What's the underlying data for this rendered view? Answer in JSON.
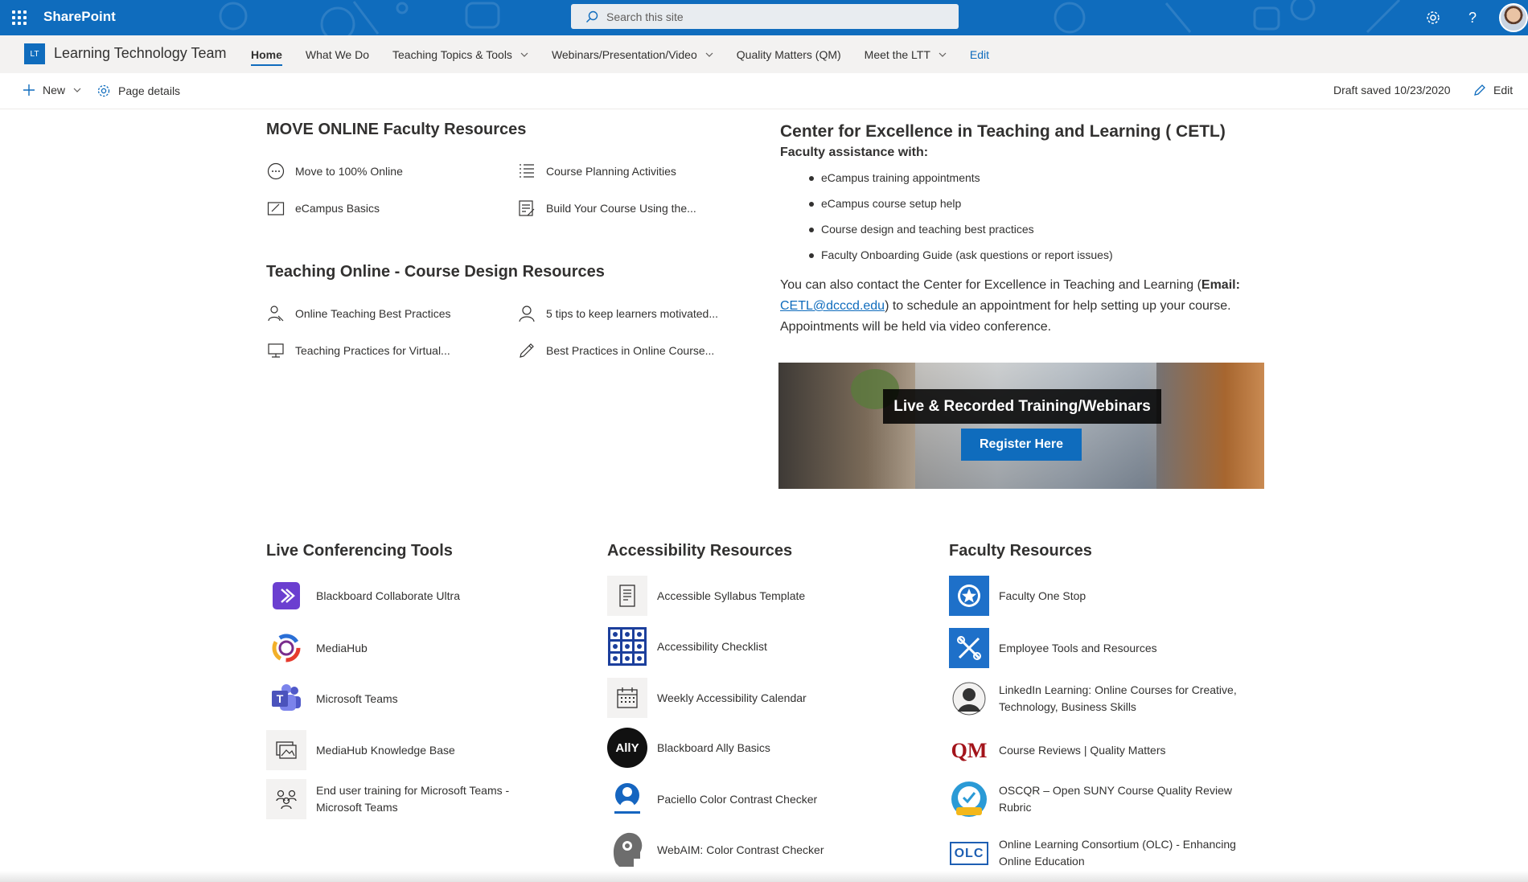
{
  "suite": {
    "brand": "SharePoint",
    "search_placeholder": "Search this site"
  },
  "site": {
    "logo_text": "LT",
    "title": "Learning Technology Team",
    "nav": [
      {
        "label": "Home",
        "active": true
      },
      {
        "label": "What We Do"
      },
      {
        "label": "Teaching Topics & Tools",
        "dropdown": true
      },
      {
        "label": "Webinars/Presentation/Video",
        "dropdown": true
      },
      {
        "label": "Quality Matters (QM)"
      },
      {
        "label": "Meet the LTT",
        "dropdown": true
      }
    ],
    "nav_edit": "Edit"
  },
  "cmd": {
    "new_label": "New",
    "page_details_label": "Page details",
    "draft_status": "Draft saved 10/23/2020",
    "edit_label": "Edit"
  },
  "move_online": {
    "title": "MOVE ONLINE Faculty Resources",
    "links": [
      "Move to 100% Online",
      "Course Planning Activities",
      "eCampus Basics",
      "Build Your Course Using the..."
    ]
  },
  "teaching_online": {
    "title": "Teaching Online - Course Design Resources",
    "links": [
      "Online Teaching Best Practices",
      "5 tips to keep learners motivated...",
      "Teaching Practices for Virtual...",
      "Best Practices in Online Course..."
    ]
  },
  "cetl": {
    "title": "Center for Excellence in Teaching and Learning ( CETL)",
    "subtitle": "Faculty assistance with:",
    "bullets": [
      "eCampus training appointments",
      "eCampus course setup help",
      "Course design and teaching best practices",
      "Faculty Onboarding Guide (ask questions or report issues)"
    ],
    "para_start": "You can also contact the Center for Excellence in Teaching and Learning (",
    "email_label": "Email:",
    "email": "CETL@dcccd.edu",
    "para_end": ") to schedule an appointment for help setting up your course. Appointments will be held via video conference."
  },
  "banner": {
    "caption": "Live & Recorded Training/Webinars",
    "button": "Register Here"
  },
  "live_tools": {
    "title": "Live Conferencing Tools",
    "items": [
      "Blackboard Collaborate Ultra",
      "MediaHub",
      "Microsoft Teams",
      "MediaHub Knowledge Base",
      "End user training for Microsoft Teams - Microsoft Teams"
    ]
  },
  "accessibility": {
    "title": "Accessibility Resources",
    "items": [
      "Accessible Syllabus Template",
      "Accessibility Checklist",
      "Weekly Accessibility Calendar",
      "Blackboard Ally Basics",
      "Paciello Color Contrast Checker",
      "WebAIM: Color Contrast Checker"
    ],
    "ally_logo_text": "AllY"
  },
  "faculty": {
    "title": "Faculty Resources",
    "items": [
      "Faculty One Stop",
      "Employee Tools and Resources",
      "LinkedIn Learning: Online Courses for Creative, Technology, Business Skills",
      "Course Reviews | Quality Matters",
      "OSCQR – Open SUNY Course Quality Review Rubric",
      "Online Learning Consortium (OLC) - Enhancing Online Education"
    ],
    "qm_logo_text": "QM",
    "olc_logo_text": "OLC"
  },
  "colors": {
    "suite_bar": "#0f6cbd",
    "accent": "#0f6cbd",
    "text": "#323130"
  }
}
